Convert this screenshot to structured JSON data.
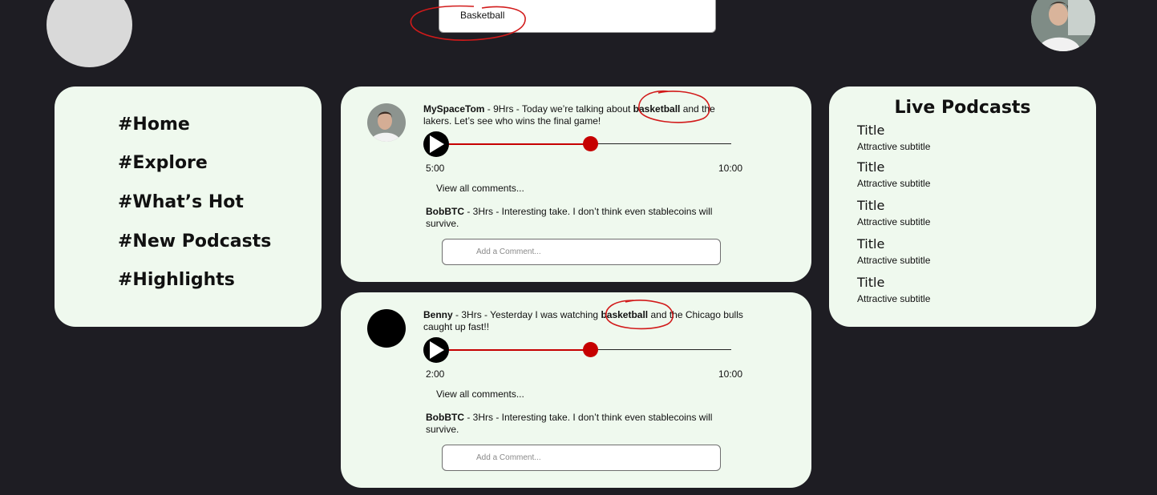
{
  "header": {
    "search": {
      "value": "Basketball",
      "placeholder": ""
    }
  },
  "nav": {
    "items": [
      {
        "label": "#Home"
      },
      {
        "label": "#Explore"
      },
      {
        "label": "#What’s Hot"
      },
      {
        "label": "#New Podcasts"
      },
      {
        "label": "#Highlights"
      }
    ]
  },
  "posts": [
    {
      "author": "MySpaceTom",
      "meta": " - 9Hrs - Today we’re talking about ",
      "keyword": "basketball",
      "rest": " and the lakers. Let’s see who wins the final game!",
      "progress": 0.5,
      "current_time": "5:00",
      "total_time": "10:00",
      "view_comments": "View all comments...",
      "comment_author": "BobBTC",
      "comment_text": " - 3Hrs - Interesting take. I don’t think even stablecoins will survive.",
      "comment_placeholder": "Add a Comment..."
    },
    {
      "author": "Benny",
      "meta": " - 3Hrs - Yesterday I was watching ",
      "keyword": "basketball",
      "rest": " and the Chicago bulls caught up fast!!",
      "progress": 0.5,
      "current_time": "2:00",
      "total_time": "10:00",
      "view_comments": "View all comments...",
      "comment_author": "BobBTC",
      "comment_text": " - 3Hrs - Interesting take. I don’t think even stablecoins will survive.",
      "comment_placeholder": "Add a Comment..."
    }
  ],
  "podcasts": {
    "heading": "Live Podcasts",
    "items": [
      {
        "title": "Title",
        "subtitle": "Attractive subtitle"
      },
      {
        "title": "Title",
        "subtitle": "Attractive subtitle"
      },
      {
        "title": "Title",
        "subtitle": "Attractive subtitle"
      },
      {
        "title": "Title",
        "subtitle": "Attractive subtitle"
      },
      {
        "title": "Title",
        "subtitle": "Attractive subtitle"
      }
    ]
  },
  "colors": {
    "background": "#1e1d23",
    "card": "#eff9ee",
    "accent": "#c60000"
  }
}
